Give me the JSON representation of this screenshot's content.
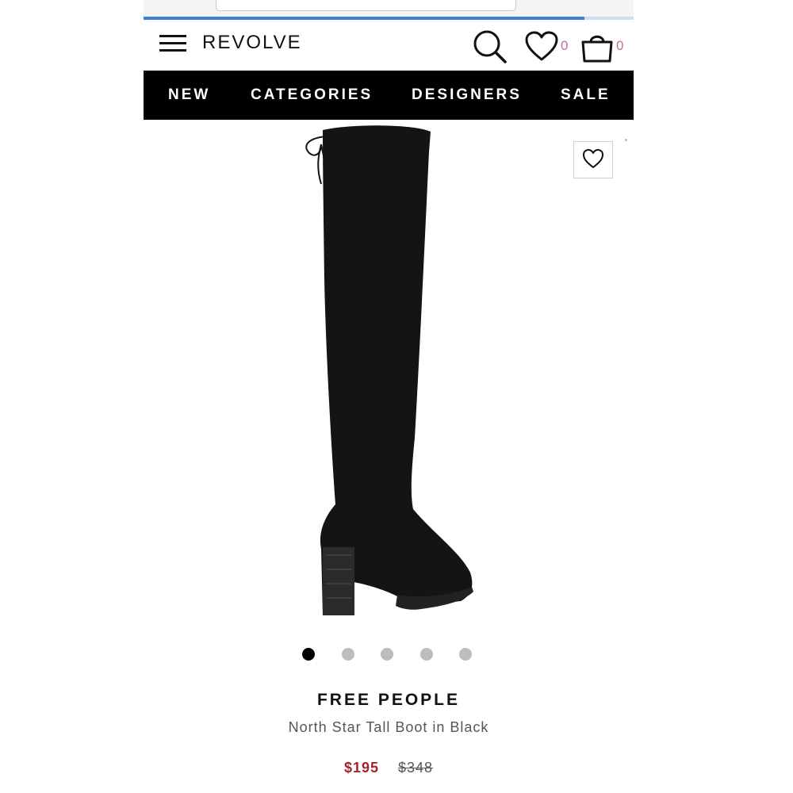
{
  "browser": {
    "load_progress": 0.9
  },
  "header": {
    "logo": "REVOLVE",
    "menu_icon": "hamburger-menu-icon",
    "search_icon": "search-icon",
    "wishlist_icon": "heart-icon",
    "wishlist_count": "0",
    "bag_icon": "shopping-bag-icon",
    "bag_count": "0",
    "count_color": "#c0709e"
  },
  "nav": {
    "items": [
      {
        "label": "NEW"
      },
      {
        "label": "CATEGORIES"
      },
      {
        "label": "DESIGNERS"
      },
      {
        "label": "SALE"
      }
    ]
  },
  "product": {
    "brand": "FREE PEOPLE",
    "name": "North Star Tall Boot in Black",
    "sale_price": "$195",
    "original_price": "$348",
    "sale_color": "#a3242f",
    "image_icon": "over-the-knee-boot-image",
    "wishlist_button_icon": "heart-outline-icon",
    "carousel": {
      "count": 5,
      "active_index": 0
    }
  }
}
